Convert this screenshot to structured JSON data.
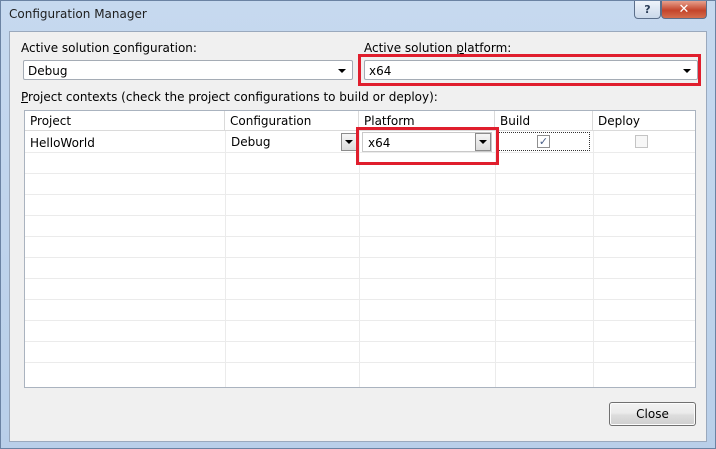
{
  "window": {
    "title": "Configuration Manager",
    "help_glyph": "?",
    "close_glyph": "✕"
  },
  "solution_config": {
    "label_pre": "Active solution ",
    "label_accel": "c",
    "label_post": "onfiguration:",
    "value": "Debug"
  },
  "solution_platform": {
    "label_pre": "Active solution ",
    "label_accel": "p",
    "label_post": "latform:",
    "value": "x64"
  },
  "contexts": {
    "label_pre": "",
    "label_accel": "P",
    "label_post": "roject contexts (check the project configurations to build or deploy):"
  },
  "grid": {
    "columns": [
      "Project",
      "Configuration",
      "Platform",
      "Build",
      "Deploy"
    ],
    "rows": [
      {
        "project": "HelloWorld",
        "configuration": "Debug",
        "platform": "x64",
        "build": true,
        "deploy": false
      }
    ]
  },
  "footer": {
    "close_label": "Close"
  },
  "colors": {
    "highlight": "#e01e2d",
    "title_bar": "#c6d9ef",
    "dialog_bg": "#f0f0f0"
  }
}
